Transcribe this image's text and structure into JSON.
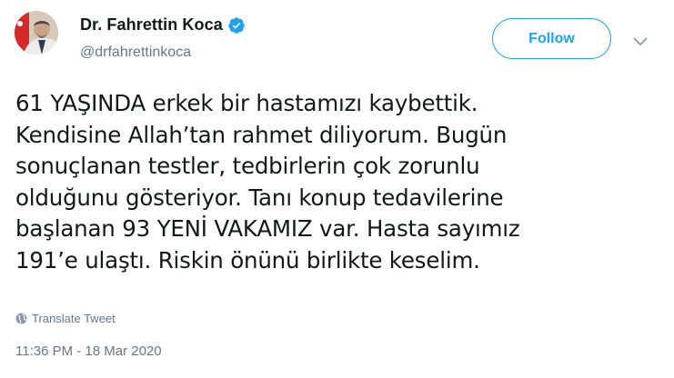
{
  "user": {
    "display_name": "Dr. Fahrettin Koca",
    "handle": "@drfahrettinkoca",
    "verified": true
  },
  "actions": {
    "follow_label": "Follow"
  },
  "tweet": {
    "lines": [
      "61 YAŞINDA erkek bir hastamızı kaybettik.",
      "Kendisine Allah’tan rahmet diliyorum. Bugün",
      "sonuçlanan testler, tedbirlerin çok zorunlu",
      "olduğunu gösteriyor. Tanı konup tedavilerine",
      "başlanan 93 YENİ VAKAMIZ var. Hasta sayımız",
      "191’e ulaştı. Riskin önünü birlikte keselim."
    ],
    "translate_label": "Translate Tweet",
    "timestamp": "11:36 PM - 18 Mar 2020"
  },
  "colors": {
    "accent": "#1da1f2",
    "text_primary": "#14171a",
    "text_secondary": "#657786"
  },
  "icons": {
    "verified": "verified-badge-icon",
    "menu": "chevron-down-icon",
    "translate": "globe-icon"
  }
}
